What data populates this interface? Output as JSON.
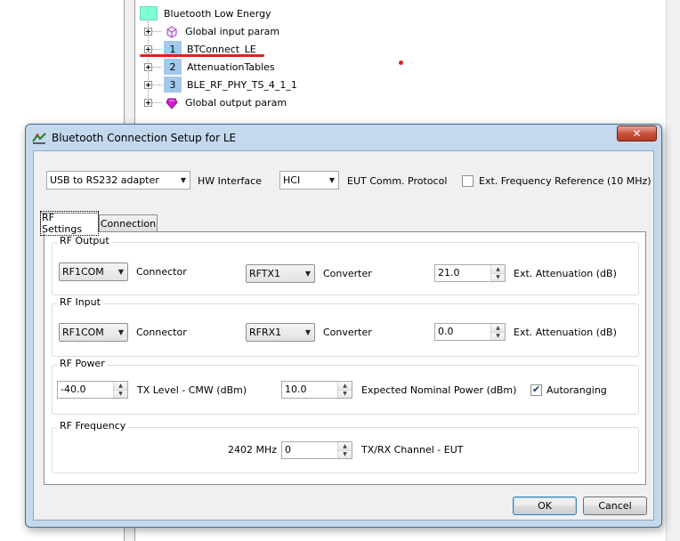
{
  "tree": {
    "root_label": "Bluetooth Low Energy",
    "items": [
      {
        "number": "",
        "label": "Global input param",
        "icon": "box-icon"
      },
      {
        "number": "1",
        "label": "BTConnect_LE",
        "icon": "number-icon"
      },
      {
        "number": "2",
        "label": "AttenuationTables",
        "icon": "number-icon"
      },
      {
        "number": "3",
        "label": "BLE_RF_PHY_TS_4_1_1",
        "icon": "number-icon"
      },
      {
        "number": "",
        "label": "Global output param",
        "icon": "gem-icon"
      }
    ]
  },
  "dialog": {
    "title": "Bluetooth Connection Setup for LE",
    "close_label": "✕",
    "hw_interface": {
      "value": "USB to RS232 adapter",
      "label": "HW Interface"
    },
    "eut_protocol": {
      "value": "HCI",
      "label": "EUT Comm. Protocol"
    },
    "ext_freq_ref": {
      "label": "Ext. Frequency Reference (10 MHz)",
      "checked": false
    },
    "tabs": [
      {
        "label": "RF Settings",
        "active": true
      },
      {
        "label": "Connection",
        "active": false
      }
    ],
    "rf_output": {
      "title": "RF Output",
      "connector_value": "RF1COM",
      "connector_label": "Connector",
      "converter_value": "RFTX1",
      "converter_label": "Converter",
      "attenuation_value": "21.0",
      "attenuation_label": "Ext. Attenuation (dB)"
    },
    "rf_input": {
      "title": "RF Input",
      "connector_value": "RF1COM",
      "connector_label": "Connector",
      "converter_value": "RFRX1",
      "converter_label": "Converter",
      "attenuation_value": "0.0",
      "attenuation_label": "Ext. Attenuation (dB)"
    },
    "rf_power": {
      "title": "RF Power",
      "tx_level_value": "-40.0",
      "tx_level_label": "TX Level - CMW (dBm)",
      "expected_power_value": "10.0",
      "expected_power_label": "Expected Nominal Power (dBm)",
      "autoranging_label": "Autoranging",
      "autoranging_checked": true
    },
    "rf_frequency": {
      "title": "RF Frequency",
      "frequency_readout": "2402 MHz",
      "channel_value": "0",
      "channel_label": "TX/RX Channel - EUT"
    },
    "ok_label": "OK",
    "cancel_label": "Cancel"
  },
  "colors": {
    "root_icon": "#7fffd4",
    "number_icon": "#a4c8ec",
    "annotation_red": "#e0201c",
    "dialog_frame": "#c4d8ee"
  }
}
